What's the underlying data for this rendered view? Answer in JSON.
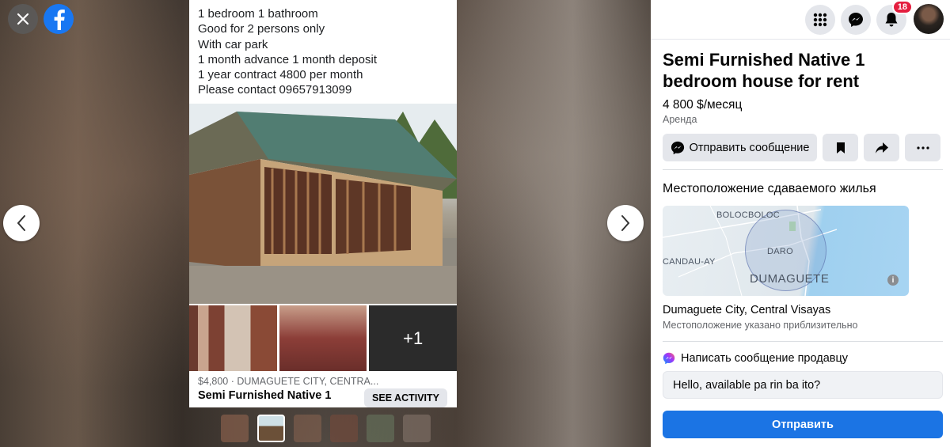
{
  "post": {
    "lines": [
      "1 bedroom 1 bathroom",
      "Good for 2 persons only",
      "With car park",
      "1 month advance 1 month deposit",
      "1 year contract 4800 per month",
      "Please contact 09657913099"
    ],
    "more_photos": "+1",
    "meta": "$4,800 · DUMAGUETE CITY, CENTRA...",
    "title": "Semi Furnished Native 1",
    "see_activity": "SEE ACTIVITY"
  },
  "topbar": {
    "notifications_count": "18"
  },
  "listing": {
    "title": "Semi Furnished Native 1 bedroom house for rent",
    "price": "4 800 $/месяц",
    "type": "Аренда",
    "message_button": "Отправить сообщение"
  },
  "location": {
    "heading": "Местоположение сдаваемого жилья",
    "map_labels": {
      "north": "BOLOCBOLOC",
      "west": "CANDAU-AY",
      "center": "DARO",
      "city": "DUMAGUETE"
    },
    "city": "Dumaguete City, Central Visayas",
    "note": "Местоположение указано приблизительно"
  },
  "message": {
    "heading": "Написать сообщение продавцу",
    "input_value": "Hello, available pa rin ba ito?",
    "send_label": "Отправить"
  },
  "colors": {
    "brand": "#1877f2",
    "send": "#1b74e4",
    "badge": "#e41e3f"
  }
}
